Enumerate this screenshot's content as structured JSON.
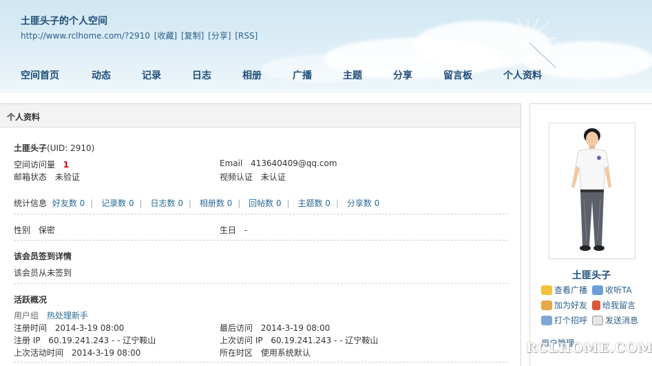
{
  "header": {
    "title": "土匪头子的个人空间",
    "url": "http://www.rclhome.com/?2910",
    "url_links": [
      "[收藏]",
      "[复制]",
      "[分享]",
      "[RSS]"
    ]
  },
  "nav": [
    "空间首页",
    "动态",
    "记录",
    "日志",
    "相册",
    "广播",
    "主题",
    "分享",
    "留言板",
    "个人资料"
  ],
  "main": {
    "heading": "个人资料",
    "username": "土匪头子",
    "uid": "(UID: 2910)",
    "visits_label": "空间访问量",
    "visits_value": "1",
    "email_label": "Email",
    "email_value": "413640409@qq.com",
    "mail_status_label": "邮箱状态",
    "mail_status_value": "未验证",
    "video_label": "视频认证",
    "video_value": "未认证",
    "stats_label": "统计信息",
    "stats": [
      "好友数 0",
      "记录数 0",
      "日志数 0",
      "相册数 0",
      "回帖数 0",
      "主题数 0",
      "分享数 0"
    ],
    "gender_label": "性别",
    "gender_value": "保密",
    "birthday_label": "生日",
    "birthday_value": "-",
    "signin_title": "该会员签到详情",
    "signin_text": "该会员从未签到",
    "activity_title": "活跃概况",
    "group_label": "用户组",
    "group_value": "热处理新手",
    "reg_time_label": "注册时间",
    "reg_time_value": "2014-3-19 08:00",
    "last_visit_label": "最后访问",
    "last_visit_value": "2014-3-19 08:00",
    "reg_ip_label": "注册 IP",
    "reg_ip_value": "60.19.241.243 - - 辽宁鞍山",
    "last_ip_label": "上次访问 IP",
    "last_ip_value": "60.19.241.243 - - 辽宁鞍山",
    "last_active_label": "上次活动时间",
    "last_active_value": "2014-3-19 08:00",
    "timezone_label": "所在时区",
    "timezone_value": "使用系统默认"
  },
  "side": {
    "name": "土匪头子",
    "actions": [
      "查看广播",
      "收听TA",
      "加为好友",
      "给我留言",
      "打个招呼",
      "发送消息"
    ],
    "manage": "用户管理"
  },
  "watermark": "RCLHOME.COM"
}
